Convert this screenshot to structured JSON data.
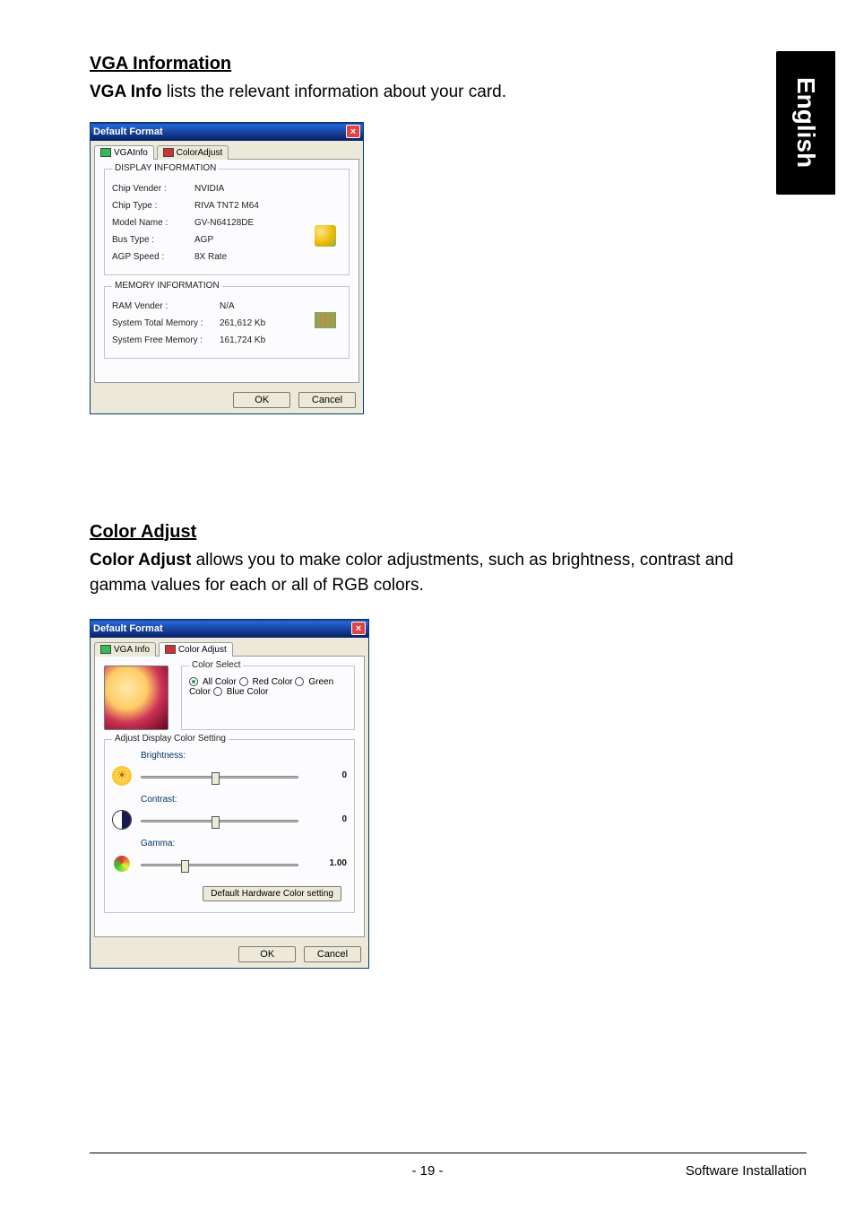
{
  "sideTab": "English",
  "section1": {
    "heading": "VGA Information",
    "lead_bold": "VGA Info",
    "lead_rest": " lists the relevant information about your card."
  },
  "dlg1": {
    "title": "Default Format",
    "tabs": {
      "vga": "VGAInfo",
      "color": "ColorAdjust"
    },
    "group1": {
      "legend": "DISPLAY INFORMATION",
      "kv": [
        {
          "k": "Chip Vender :",
          "v": "NVIDIA"
        },
        {
          "k": "Chip Type :",
          "v": "RIVA TNT2 M64"
        },
        {
          "k": "Model Name :",
          "v": "GV-N64128DE"
        },
        {
          "k": "Bus Type :",
          "v": "AGP"
        },
        {
          "k": "AGP Speed :",
          "v": "8X Rate"
        }
      ]
    },
    "group2": {
      "legend": "MEMORY INFORMATION",
      "kv": [
        {
          "k": "RAM Vender :",
          "v": "N/A"
        },
        {
          "k": "System Total Memory :",
          "v": "261,612 Kb"
        },
        {
          "k": "System Free Memory :",
          "v": "161,724 Kb"
        }
      ]
    },
    "buttons": {
      "ok": "OK",
      "cancel": "Cancel"
    }
  },
  "section2": {
    "heading": "Color Adjust",
    "lead_bold": "Color Adjust",
    "lead_rest": " allows you to make color adjustments, such as brightness, contrast and gamma values for each or all of RGB colors."
  },
  "dlg2": {
    "title": "Default Format",
    "tabs": {
      "vga": "VGA Info",
      "color": "Color Adjust"
    },
    "colorSelect": {
      "legend": "Color Select",
      "options": [
        "All Color",
        "Red Color",
        "Green Color",
        "Blue Color"
      ]
    },
    "adjustGroup": {
      "legend": "Adjust Display Color Setting",
      "sliders": [
        {
          "label": "Brightness:",
          "value": "0"
        },
        {
          "label": "Contrast:",
          "value": "0"
        },
        {
          "label": "Gamma:",
          "value": "1.00"
        }
      ],
      "defaultBtn": "Default Hardware Color setting"
    },
    "buttons": {
      "ok": "OK",
      "cancel": "Cancel"
    }
  },
  "footer": {
    "page": "- 19 -",
    "section": "Software Installation"
  }
}
